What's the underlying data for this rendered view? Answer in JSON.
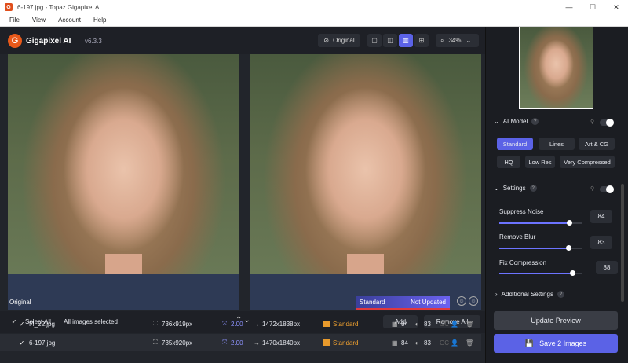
{
  "window": {
    "title": "6-197.jpg - Topaz Gigapixel AI",
    "minimize": "—",
    "maximize": "☐",
    "close": "✕"
  },
  "menu": {
    "items": [
      "File",
      "View",
      "Account",
      "Help"
    ]
  },
  "app": {
    "logo": "G",
    "name": "Gigapixel AI",
    "version": "v6.3.3"
  },
  "toolbar": {
    "original_label": "Original",
    "zoom_value": "34%"
  },
  "preview": {
    "left_label": "Original",
    "model_status": "Standard",
    "update_status": "Not Updated"
  },
  "list": {
    "select_all": "Select All",
    "selection_text": "All images selected",
    "add_label": "Add",
    "remove_all_label": "Remove All",
    "rows": [
      {
        "name": "f4_22.jpg",
        "input_size": "736x919px",
        "scale": "2.00",
        "output_size": "1472x1838px",
        "model": "Standard",
        "noise": "84",
        "blur": "83",
        "gc": "GC"
      },
      {
        "name": "6-197.jpg",
        "input_size": "735x920px",
        "scale": "2.00",
        "output_size": "1470x1840px",
        "model": "Standard",
        "noise": "84",
        "blur": "83",
        "gc": "GC"
      }
    ]
  },
  "sidebar": {
    "ai_model": {
      "title": "AI Model",
      "options": [
        "Standard",
        "Lines",
        "Art & CG",
        "HQ",
        "Low Res",
        "Very Compressed"
      ],
      "selected": "Standard"
    },
    "settings": {
      "title": "Settings",
      "suppress_noise": {
        "label": "Suppress Noise",
        "value": "84"
      },
      "remove_blur": {
        "label": "Remove Blur",
        "value": "83"
      },
      "fix_compression": {
        "label": "Fix Compression",
        "value": "88"
      }
    },
    "additional_settings": "Additional Settings",
    "update_preview": "Update Preview",
    "save_label": "Save 2 Images"
  },
  "colors": {
    "accent": "#5b62e6",
    "model_orange": "#f0a12f",
    "panel": "#1b1d22"
  }
}
